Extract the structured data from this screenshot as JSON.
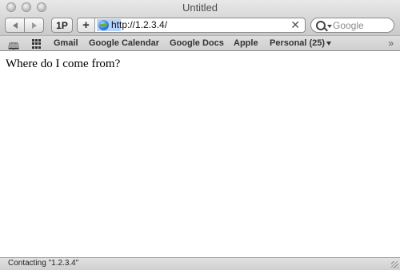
{
  "window": {
    "title": "Untitled"
  },
  "toolbar": {
    "onepassword_label": "1P",
    "add_label": "+",
    "url_value": "http://1.2.3.4/",
    "clear_label": "✕",
    "search_placeholder": "Google"
  },
  "bookmarks": {
    "items": [
      {
        "label": "Gmail"
      },
      {
        "label": "Google Calendar"
      },
      {
        "label": "Google Docs"
      },
      {
        "label": "Apple"
      },
      {
        "label": "Personal (25)"
      }
    ],
    "overflow": "»"
  },
  "content": {
    "text": "Where do I come from?"
  },
  "status": {
    "text": "Contacting \"1.2.3.4\""
  }
}
